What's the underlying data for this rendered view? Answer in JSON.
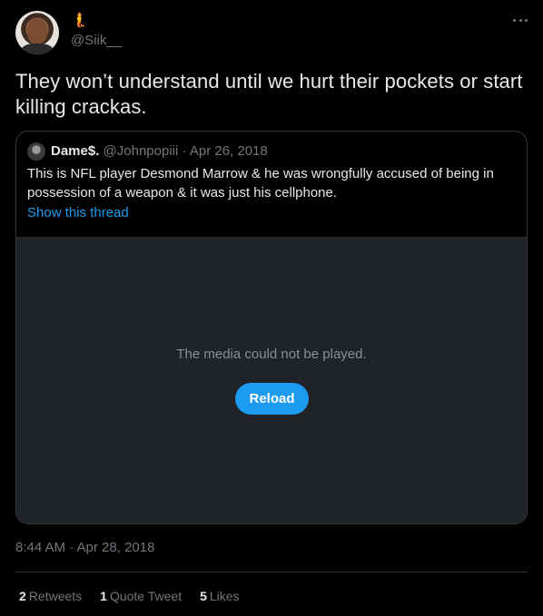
{
  "author": {
    "display_emoji": "🧜",
    "handle": "@Siik__",
    "avatar_icon": "profile-photo"
  },
  "tweet": {
    "text": "They won’t understand until we hurt their pockets or start killing crackas.",
    "timestamp": "8:44 AM · Apr 28, 2018"
  },
  "quoted": {
    "name": "Dame$.",
    "handle": "@Johnpopiii",
    "date": "Apr 26, 2018",
    "separator": "·",
    "text": "This is NFL player Desmond Marrow & he was wrongfully accused of being in possession of a weapon & it was just his cellphone.",
    "show_thread": "Show this thread"
  },
  "media": {
    "message": "The media could not be played.",
    "reload_label": "Reload"
  },
  "stats": {
    "retweets_count": "2",
    "retweets_label": "Retweets",
    "quotes_count": "1",
    "quotes_label": "Quote Tweet",
    "likes_count": "5",
    "likes_label": "Likes"
  },
  "colors": {
    "background": "#000000",
    "text": "#e7e9ea",
    "muted": "#71767b",
    "accent": "#1d9bf0",
    "border": "#333639",
    "media_bg": "#202327"
  }
}
